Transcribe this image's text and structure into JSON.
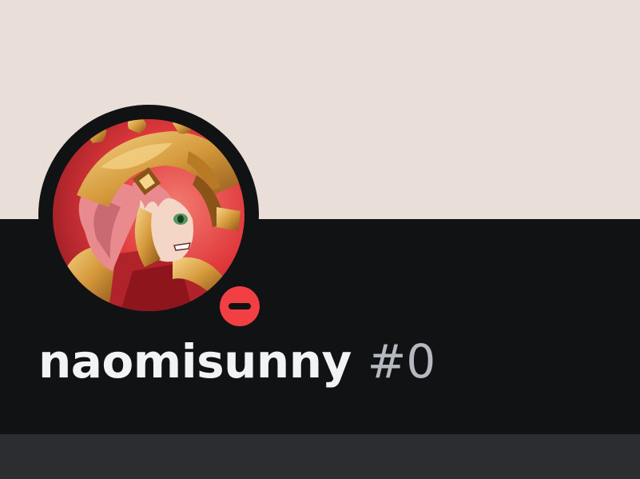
{
  "profile": {
    "username": "naomisunny",
    "discriminator": "#0",
    "status": "do-not-disturb",
    "avatar_icon": "avatar-armored-red-haired-character"
  },
  "colors": {
    "banner": "#EADFD8",
    "panel": "#111214",
    "bottom_strip": "#2B2D31",
    "username": "#F2F3F5",
    "discriminator": "#B5BAC1",
    "status_dnd": "#F23F43",
    "avatar_bg": "#E0393C",
    "avatar_gold": "#D69A3C",
    "avatar_hair": "#E98A8E"
  }
}
